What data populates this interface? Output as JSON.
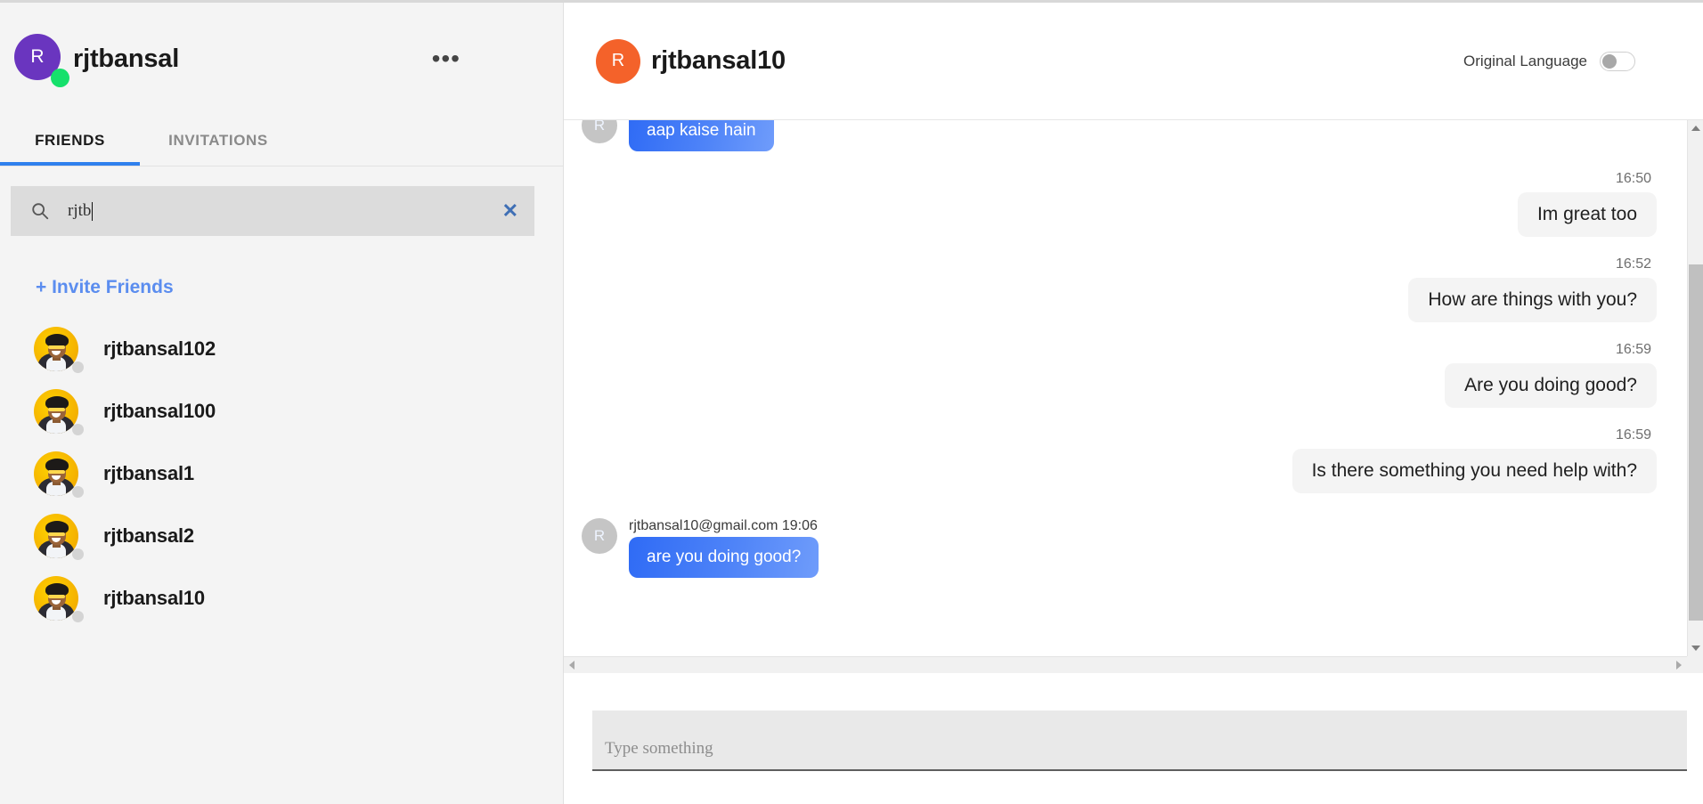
{
  "sidebar": {
    "user": {
      "name": "rjtbansal",
      "initial": "R",
      "avatar_color": "#6a35bf",
      "status_color": "#15e06b"
    },
    "more_icon": "•••",
    "tabs": [
      {
        "label": "FRIENDS",
        "active": true
      },
      {
        "label": "INVITATIONS",
        "active": false
      }
    ],
    "search": {
      "value": "rjtb",
      "placeholder": "",
      "clear_label": "✕"
    },
    "invite_label": "+ Invite Friends",
    "friends": [
      {
        "name": "rjtbansal102"
      },
      {
        "name": "rjtbansal100"
      },
      {
        "name": "rjtbansal1"
      },
      {
        "name": "rjtbansal2"
      },
      {
        "name": "rjtbansal10"
      }
    ]
  },
  "chat": {
    "header": {
      "initial": "R",
      "title": "rjtbansal10",
      "avatar_color": "#f4622a",
      "original_language_label": "Original Language",
      "toggle_on": false
    },
    "messages": [
      {
        "dir": "in",
        "initial": "R",
        "meta": "",
        "text": "aap kaise hain",
        "clipped": true
      },
      {
        "dir": "out",
        "time": "16:50",
        "text": "Im great too"
      },
      {
        "dir": "out",
        "time": "16:52",
        "text": "How are things with you?"
      },
      {
        "dir": "out",
        "time": "16:59",
        "text": "Are you doing good?"
      },
      {
        "dir": "out",
        "time": "16:59",
        "text": "Is there something you need help with?"
      },
      {
        "dir": "in",
        "initial": "R",
        "meta": "rjtbansal10@gmail.com 19:06",
        "text": "are you doing good?"
      }
    ],
    "composer": {
      "placeholder": "Type something",
      "value": ""
    }
  }
}
